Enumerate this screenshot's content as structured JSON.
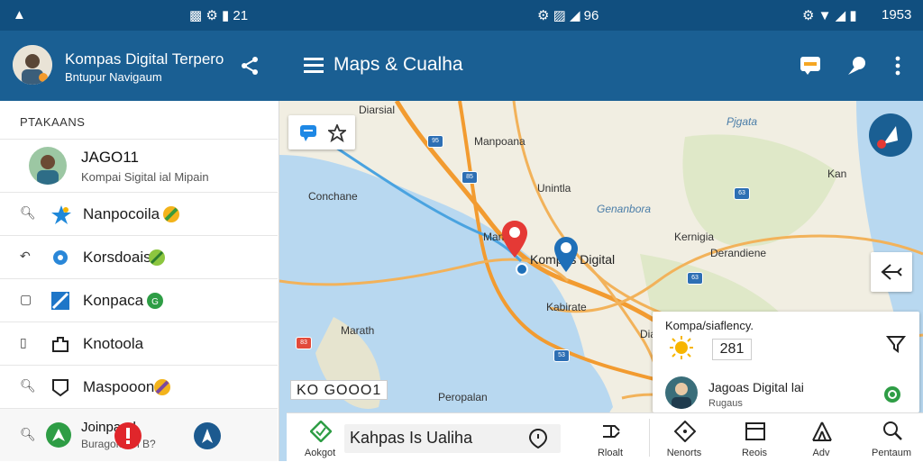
{
  "status_bar": {
    "left": "▲",
    "left_icons": "▩ ⚙ ▮ 21",
    "center": "⚙ ▨ ◢ 96",
    "right": "1953"
  },
  "app_header": {
    "title": "Kompas Digital Terpero",
    "subtitle": "Bntupur Navigaum"
  },
  "toolbar": {
    "title": "Maps & Cualha"
  },
  "left_panel": {
    "section_title": "PTAKAANS",
    "profile": {
      "name": "JAGO11",
      "subtitle": "Kompai Sigital ial Mipain"
    },
    "items": [
      {
        "label": "Nanpocoila"
      },
      {
        "label": "Korsdoais"
      },
      {
        "label": "Konpaca"
      },
      {
        "label": "Knotoola"
      },
      {
        "label": "Maspooon"
      }
    ],
    "bottom": {
      "line1": "Joinparal",
      "line2": "Buragoio on B?"
    }
  },
  "map": {
    "labels": {
      "diarsial": "Diarsial",
      "pjgata": "Pjgata",
      "manpoana": "Manpoana",
      "unintla": "Unintla",
      "conchane": "Conchane",
      "genanbora": "Genanbora",
      "kan": "Kan",
      "kernigia": "Kernigia",
      "derandiene": "Derandiene",
      "kompas_digital": "Kompas Digital",
      "kabirate": "Kabirate",
      "mandi": "Mandi",
      "marath": "Marath",
      "peropalan": "Peropalan",
      "dian": "Dian"
    },
    "scale_text": "KO GOOO1"
  },
  "info_card": {
    "title": "Kompa/siaflency.",
    "value": "281",
    "user_name": "Jagoas Digital lai",
    "user_sub": "Rugaus"
  },
  "bottom_bar": {
    "left_label": "Aokgot",
    "search_text": "Kahpas Is Ualiha",
    "items": [
      {
        "label": "Rloalt"
      },
      {
        "label": "Nenorts"
      },
      {
        "label": "Reois"
      },
      {
        "label": "Adv"
      },
      {
        "label": "Pentaum"
      }
    ]
  },
  "colors": {
    "status_bar": "#114f7f",
    "app_bar": "#1a5f93",
    "route": "#4aa3e0",
    "pin_red": "#e53935",
    "pin_blue": "#1e6fb8",
    "water": "#b8d8f0",
    "land": "#f1eee2"
  }
}
